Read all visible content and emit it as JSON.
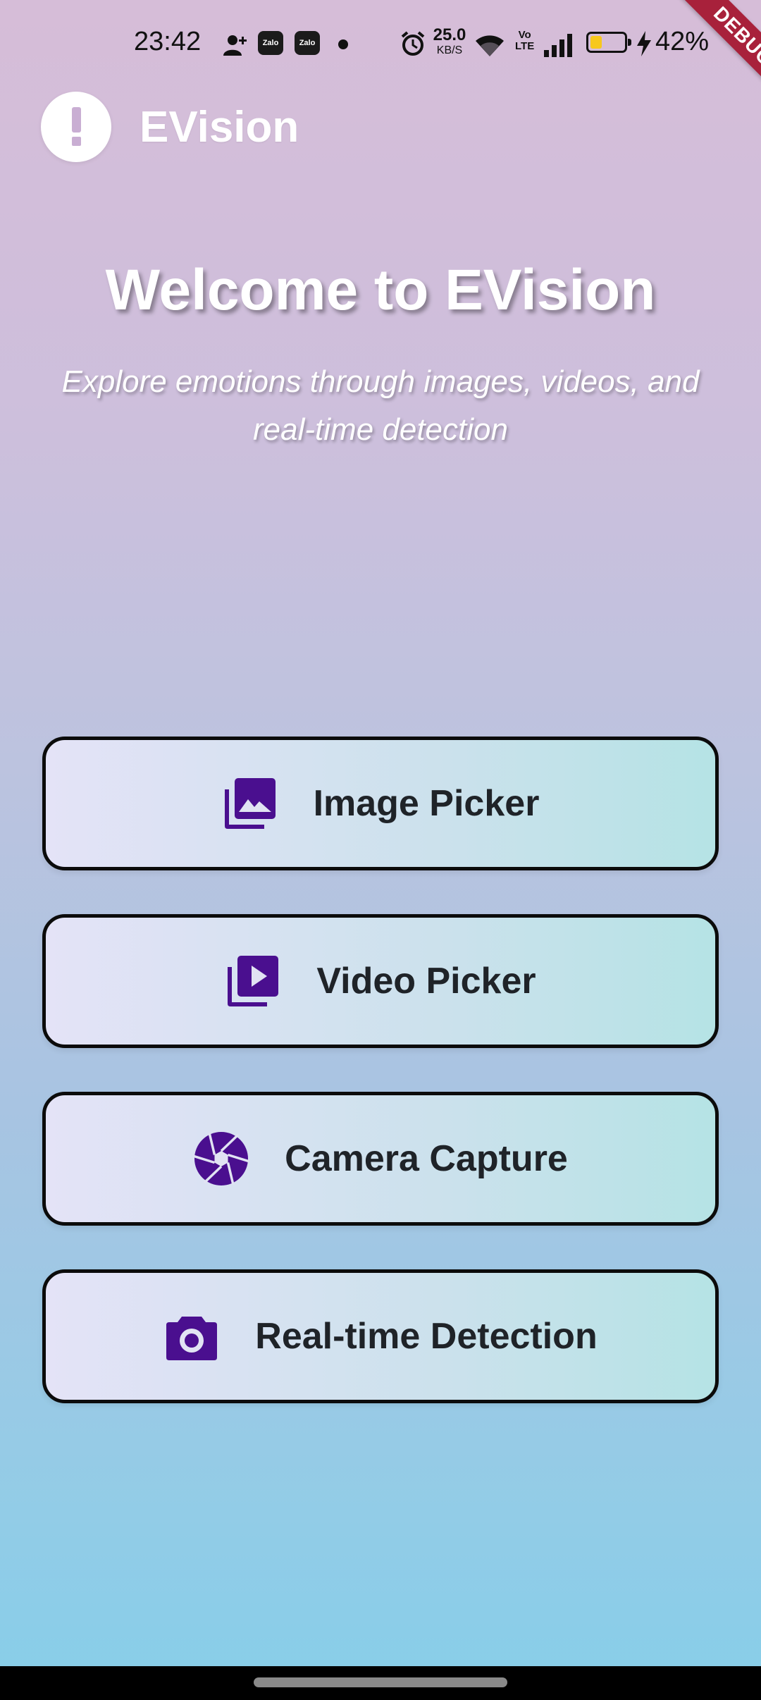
{
  "status_bar": {
    "time": "23:42",
    "zalo_label": "Zalo",
    "net_speed_value": "25.0",
    "net_speed_unit": "KB/S",
    "volte_top": "Vo",
    "volte_bottom": "LTE",
    "battery_percent": "42%",
    "battery_level": 0.42
  },
  "debug_banner": "DEBUG",
  "header": {
    "app_name": "EVision",
    "logo_icon": "exclamation-icon"
  },
  "hero": {
    "title": "Welcome to EVision",
    "subtitle": "Explore emotions through images, videos, and real-time detection"
  },
  "actions": [
    {
      "label": "Image Picker",
      "icon": "photo-library-icon"
    },
    {
      "label": "Video Picker",
      "icon": "video-library-icon"
    },
    {
      "label": "Camera Capture",
      "icon": "camera-aperture-icon"
    },
    {
      "label": "Real-time Detection",
      "icon": "camera-icon"
    }
  ],
  "colors": {
    "icon_purple": "#4a0f8f",
    "button_border": "#0b0b0b",
    "label_text": "#1f2328",
    "debug_red": "#a8213b"
  }
}
